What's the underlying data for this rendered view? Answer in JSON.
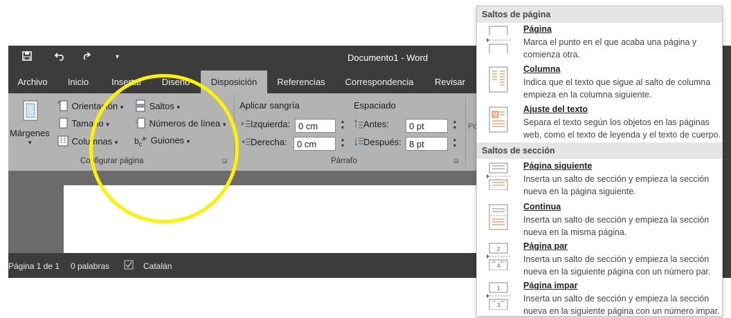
{
  "window": {
    "title": "Documento1  -  Word"
  },
  "quick_access": {
    "save_icon": "save-icon",
    "undo_icon": "undo-icon",
    "redo_icon": "redo-icon",
    "customize_icon": "customize-qat-icon"
  },
  "tabs": [
    {
      "label": "Archivo"
    },
    {
      "label": "Inicio"
    },
    {
      "label": "Insertar"
    },
    {
      "label": "Diseño"
    },
    {
      "label": "Disposición",
      "active": true
    },
    {
      "label": "Referencias"
    },
    {
      "label": "Correspondencia"
    },
    {
      "label": "Revisar"
    }
  ],
  "page_setup": {
    "margins": "Márgenes",
    "orientation": "Orientación",
    "size": "Tamaño",
    "columns": "Columnas",
    "breaks": "Saltos",
    "line_numbers": "Números de línea",
    "hyphenation": "Guiones",
    "group_label": "Configurar página"
  },
  "paragraph": {
    "indent_label": "Aplicar sangría",
    "spacing_label": "Espaciado",
    "left_label": "Izquierda:",
    "left_value": "0 cm",
    "right_label": "Derecha:",
    "right_value": "0 cm",
    "before_label": "Antes:",
    "before_value": "0 pt",
    "after_label": "Después:",
    "after_value": "8 pt",
    "group_label": "Párrafo",
    "partial_label": "Po"
  },
  "status": {
    "page": "Página 1 de 1",
    "words": "0 palabras",
    "language": "Catalán"
  },
  "breaks_menu": {
    "page_breaks_header": "Saltos de página",
    "section_breaks_header": "Saltos de sección",
    "page_items": [
      {
        "title": "Página",
        "desc": "Marca el punto en el que acaba una página y comienza otra."
      },
      {
        "title": "Columna",
        "desc": "Indica que el texto que sigue al salto de columna empieza en la columna siguiente."
      },
      {
        "title": "Ajuste del texto",
        "desc": "Separa el texto según los objetos en las páginas web, como el texto de leyenda y el texto de cuerpo."
      }
    ],
    "section_items": [
      {
        "title": "Página siguiente",
        "desc": "Inserta un salto de sección y empieza la sección nueva en la página siguiente."
      },
      {
        "title": "Continua",
        "desc": "Inserta un salto de sección y empieza la sección nueva en la misma página."
      },
      {
        "title": "Página par",
        "desc": "Inserta un salto de sección y empieza la sección nueva en la siguiente página con un número par."
      },
      {
        "title": "Página impar",
        "desc": "Inserta un salto de sección y empieza la sección nueva en la siguiente página con un número impar."
      }
    ]
  },
  "colors": {
    "highlight_circle": "#fff200",
    "title_bar": "#3c3c3c",
    "ribbon": "#b3b3b3"
  }
}
